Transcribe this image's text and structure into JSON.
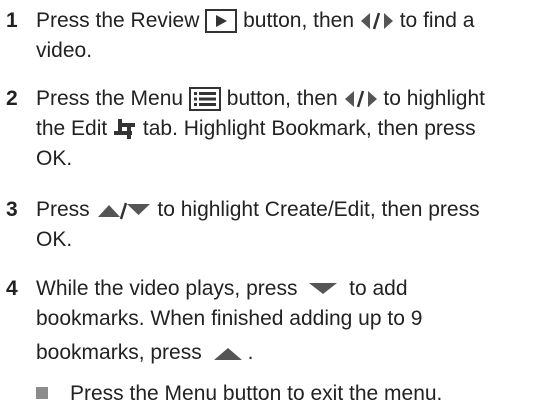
{
  "steps": [
    {
      "number": "1",
      "line1": {
        "t1": "Press the Review",
        "t2": "button, then",
        "t3": "to find a"
      },
      "line2": "video."
    },
    {
      "number": "2",
      "line1": {
        "t1": "Press the Menu",
        "t2": "button, then",
        "t3": "to highlight"
      },
      "line2": {
        "t1": "the Edit",
        "t2": "tab. Highlight Bookmark, then press"
      },
      "line3": "OK."
    },
    {
      "number": "3",
      "line1": {
        "t1": "Press",
        "t2": "to highlight Create/Edit, then press"
      },
      "line2": "OK."
    },
    {
      "number": "4",
      "line1": {
        "t1": "While the video plays, press",
        "t2": "to add"
      },
      "line2": "bookmarks. When finished adding up to 9",
      "line3": {
        "t1": "bookmarks, press",
        "t2": "."
      }
    }
  ],
  "bullet": "Press the Menu button to exit the menu.",
  "icons": {
    "review": "review-button-icon",
    "left_right": "left-right-arrow-icon",
    "menu": "menu-button-icon",
    "edit": "edit-tab-icon",
    "up_down": "up-down-arrow-icon",
    "down": "down-arrow-icon",
    "up": "up-arrow-icon"
  }
}
